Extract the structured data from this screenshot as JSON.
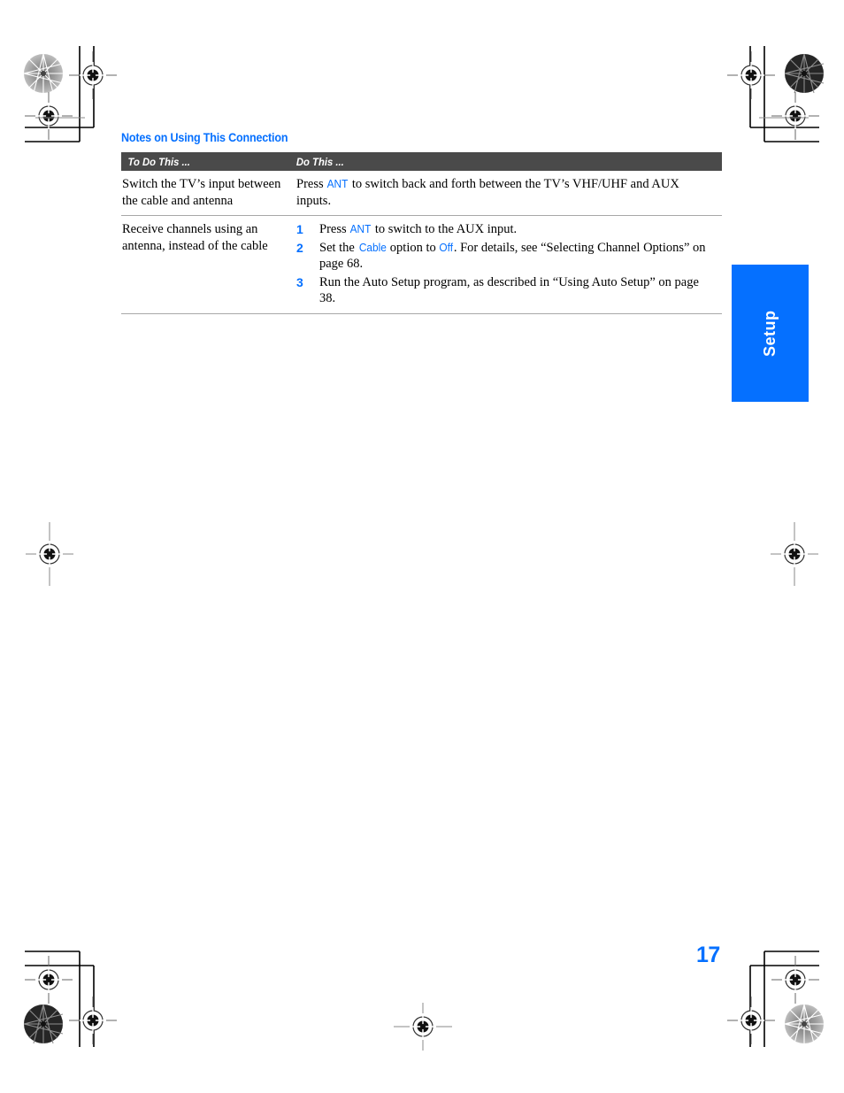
{
  "page": {
    "number": "17",
    "side_tab_label": "Setup",
    "accent_color": "#0570ff",
    "header_bar_color": "#4a4a4a",
    "rule_color": "#a8a8a8"
  },
  "section": {
    "title": "Notes on Using This Connection"
  },
  "table": {
    "columns": [
      {
        "label": "To Do This ..."
      },
      {
        "label": "Do This ..."
      }
    ],
    "rows": [
      {
        "task": "Switch the TV’s input between the cable and antenna",
        "type": "paragraph",
        "action": {
          "before": "Press ",
          "keyword": "ANT",
          "after": " to switch back and forth between the TV’s VHF/UHF and AUX inputs."
        }
      },
      {
        "task": "Receive channels using an antenna, instead of the cable",
        "type": "steps",
        "steps": [
          {
            "number": "1",
            "parts": [
              {
                "text": "Press ",
                "style": "plain"
              },
              {
                "text": "ANT",
                "style": "keyword"
              },
              {
                "text": " to switch to the AUX input.",
                "style": "plain"
              }
            ]
          },
          {
            "number": "2",
            "parts": [
              {
                "text": "Set the ",
                "style": "plain"
              },
              {
                "text": "Cable",
                "style": "keyword"
              },
              {
                "text": " option to ",
                "style": "plain"
              },
              {
                "text": "Off",
                "style": "keyword"
              },
              {
                "text": ". For details, see “Selecting Channel Options” on page 68.",
                "style": "plain"
              }
            ]
          },
          {
            "number": "3",
            "parts": [
              {
                "text": "Run the Auto Setup program, as described in “Using Auto Setup” on page 38.",
                "style": "plain"
              }
            ]
          }
        ]
      }
    ]
  },
  "prepress": {
    "crop_mark_color": "#000000",
    "registration_mark_color": "#555555"
  }
}
